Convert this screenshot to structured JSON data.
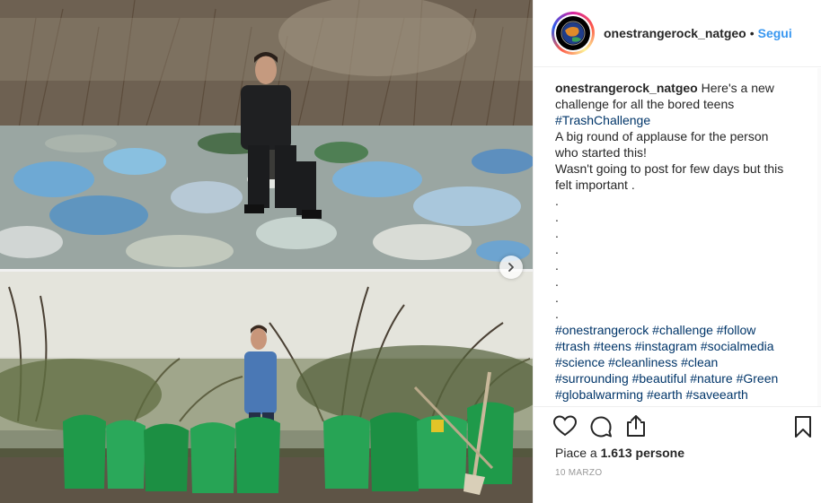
{
  "post": {
    "username": "onestrangerock_natgeo",
    "separator": "•",
    "follow_label": "Segui",
    "avatar_icon": "planet-earth-avatar",
    "caption": {
      "username": "onestrangerock_natgeo",
      "lines": [
        " Here's a new",
        "challenge for all the bored teens",
        "#TrashChallenge",
        "A big round of applause for the person",
        "who started this!",
        "Wasn't going to post for few days but this",
        "felt important .",
        ".",
        ".",
        ".",
        ".",
        ".",
        ".",
        ".",
        ".",
        "#onestrangerock #challenge #follow",
        "#trash #teens #instagram #socialmedia",
        "#science #cleanliness #clean",
        "#surrounding #beautiful #nature #Green",
        "#globalwarming #earth #saveearth"
      ]
    },
    "likes_prefix": "Piace a ",
    "likes_count": "1.613",
    "likes_suffix": " persone",
    "date": "10 MARZO",
    "icons": {
      "like": "heart-icon",
      "comment": "comment-icon",
      "share": "share-icon",
      "save": "bookmark-icon",
      "next": "chevron-right-icon"
    },
    "colors": {
      "link": "#3897f0",
      "hashtag": "#003569",
      "text": "#262626",
      "muted": "#999999",
      "border": "#efefef"
    }
  }
}
